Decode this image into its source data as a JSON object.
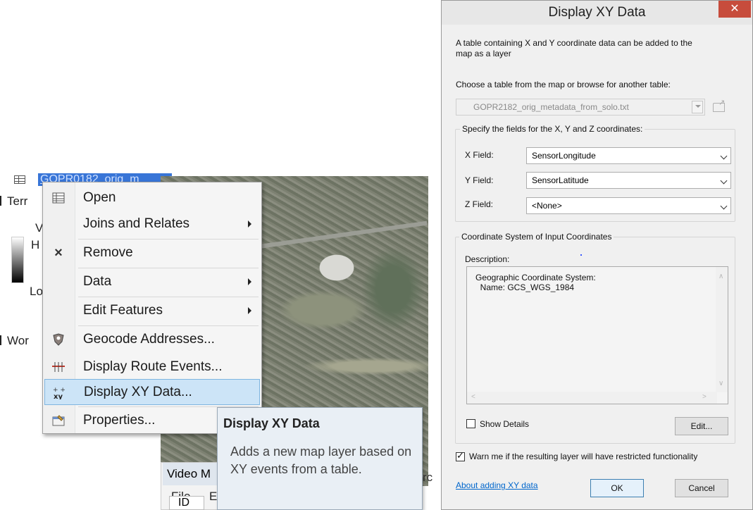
{
  "toc": {
    "selected_layer_name": "GOPR0182_orig_m",
    "items": [
      "Terr",
      "V",
      "H",
      "Lo",
      "Wor"
    ]
  },
  "context_menu": {
    "items": [
      {
        "label": "Open",
        "icon": "table-icon",
        "submenu": false
      },
      {
        "label": "Joins and Relates",
        "icon": "",
        "submenu": true
      },
      {
        "label": "Remove",
        "icon": "remove-x-icon",
        "submenu": false
      },
      {
        "label": "Data",
        "icon": "",
        "submenu": true
      },
      {
        "label": "Edit Features",
        "icon": "",
        "submenu": true
      },
      {
        "label": "Geocode Addresses...",
        "icon": "geocode-icon",
        "submenu": false
      },
      {
        "label": "Display Route Events...",
        "icon": "route-events-icon",
        "submenu": false
      },
      {
        "label": "Display XY Data...",
        "icon": "xy-data-icon",
        "submenu": false,
        "highlighted": true
      },
      {
        "label": "Properties...",
        "icon": "properties-icon",
        "submenu": false
      }
    ]
  },
  "tooltip": {
    "title": "Display XY Data",
    "body": "Adds a new map layer based on XY events from a table."
  },
  "video_window": {
    "title": "Video M",
    "menu_file": "File",
    "menu_e": "E",
    "column_id": "ID",
    "right_partial": "rc"
  },
  "dialog": {
    "title": "Display XY Data",
    "close_symbol": "✕",
    "intro": "A table containing X and Y coordinate data can be added to the map as a layer",
    "intro_line1": "A table containing X and Y coordinate data can be added to the",
    "intro_line2": "map as a layer",
    "choose_label": "Choose a table from the map or browse for another table:",
    "table_value": "GOPR2182_orig_metadata_from_solo.txt",
    "fields_group": "Specify the fields for the X, Y and Z coordinates:",
    "x_label": "X Field:",
    "x_value": "SensorLongitude",
    "y_label": "Y Field:",
    "y_value": "SensorLatitude",
    "z_label": "Z Field:",
    "z_value": "<None>",
    "cs_group": "Coordinate System of Input Coordinates",
    "description_label": "Description:",
    "description_line1": "Geographic Coordinate System:",
    "description_line2": "  Name: GCS_WGS_1984",
    "show_details": "Show Details",
    "show_details_checked": false,
    "edit_button": "Edit...",
    "warn_label": "Warn me if the resulting layer will have restricted functionality",
    "warn_checked": true,
    "about_link": "About adding XY data",
    "ok_button": "OK",
    "cancel_button": "Cancel"
  },
  "colors": {
    "selection_blue": "#3875d7",
    "menu_highlight": "#cce4f7",
    "close_red": "#c74c3c",
    "link_blue": "#0066cc"
  }
}
